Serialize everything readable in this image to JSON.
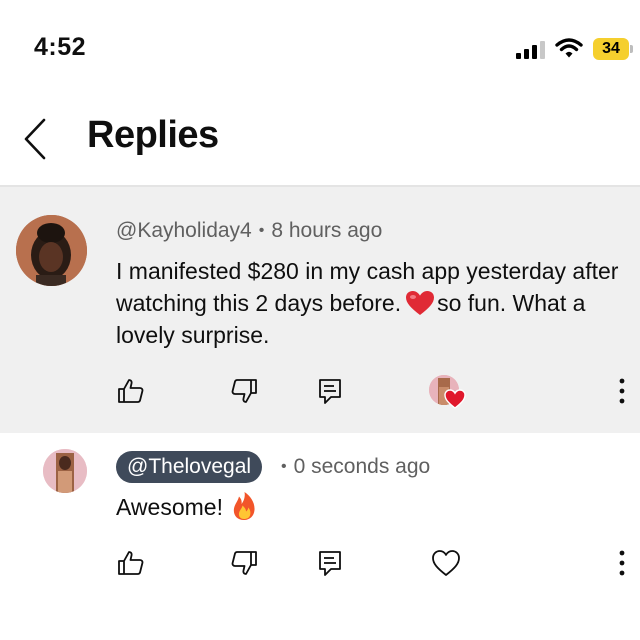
{
  "status_bar": {
    "time": "4:52",
    "battery": "34",
    "battery_color": "#f5cf2e"
  },
  "header": {
    "title": "Replies",
    "back_icon": "chevron-left-icon"
  },
  "comment": {
    "author": "@Kayholiday4",
    "separator": "•",
    "time": "8 hours ago",
    "text_before": "I manifested $280 in my cash app yesterday after watching this 2 days before.",
    "emoji": "red-heart",
    "text_after": "so fun. What a lovely surprise.",
    "background": "#f0f0f0"
  },
  "reply": {
    "author": "@Thelovegal",
    "separator": "•",
    "time": "0 seconds ago",
    "text": "Awesome!",
    "emoji": "fire",
    "chip_color": "#3f4a5a"
  },
  "actions": {
    "icons": [
      "thumbs-up-icon",
      "thumbs-down-icon",
      "reply-icon",
      "heart-icon",
      "more-vert-icon"
    ]
  }
}
